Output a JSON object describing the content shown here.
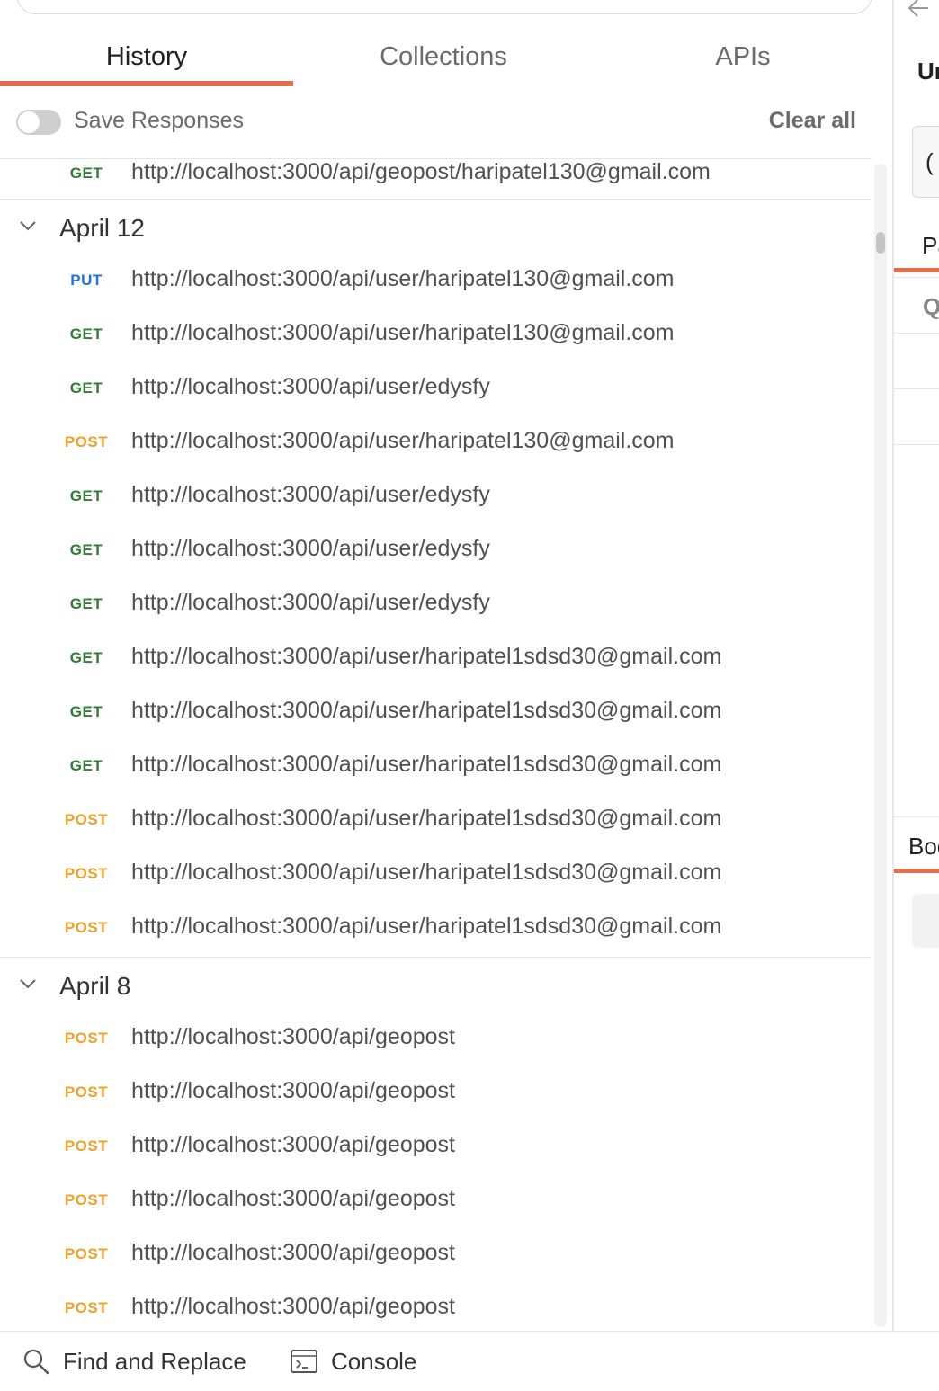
{
  "tabs": [
    {
      "label": "History"
    },
    {
      "label": "Collections"
    },
    {
      "label": "APIs"
    }
  ],
  "toolbar": {
    "save_responses_label": "Save Responses",
    "save_responses_on": false,
    "clear_all_label": "Clear all"
  },
  "history": {
    "top_row": {
      "method": "GET",
      "url": "http://localhost:3000/api/geopost/haripatel130@gmail.com"
    },
    "groups": [
      {
        "date": "April 12",
        "items": [
          {
            "method": "PUT",
            "url": "http://localhost:3000/api/user/haripatel130@gmail.com"
          },
          {
            "method": "GET",
            "url": "http://localhost:3000/api/user/haripatel130@gmail.com"
          },
          {
            "method": "GET",
            "url": "http://localhost:3000/api/user/edysfy"
          },
          {
            "method": "POST",
            "url": "http://localhost:3000/api/user/haripatel130@gmail.com"
          },
          {
            "method": "GET",
            "url": "http://localhost:3000/api/user/edysfy"
          },
          {
            "method": "GET",
            "url": "http://localhost:3000/api/user/edysfy"
          },
          {
            "method": "GET",
            "url": "http://localhost:3000/api/user/edysfy"
          },
          {
            "method": "GET",
            "url": "http://localhost:3000/api/user/haripatel1sdsd30@gmail.com"
          },
          {
            "method": "GET",
            "url": "http://localhost:3000/api/user/haripatel1sdsd30@gmail.com"
          },
          {
            "method": "GET",
            "url": "http://localhost:3000/api/user/haripatel1sdsd30@gmail.com"
          },
          {
            "method": "POST",
            "url": "http://localhost:3000/api/user/haripatel1sdsd30@gmail.com"
          },
          {
            "method": "POST",
            "url": "http://localhost:3000/api/user/haripatel1sdsd30@gmail.com"
          },
          {
            "method": "POST",
            "url": "http://localhost:3000/api/user/haripatel1sdsd30@gmail.com"
          }
        ]
      },
      {
        "date": "April 8",
        "items": [
          {
            "method": "POST",
            "url": "http://localhost:3000/api/geopost"
          },
          {
            "method": "POST",
            "url": "http://localhost:3000/api/geopost"
          },
          {
            "method": "POST",
            "url": "http://localhost:3000/api/geopost"
          },
          {
            "method": "POST",
            "url": "http://localhost:3000/api/geopost"
          },
          {
            "method": "POST",
            "url": "http://localhost:3000/api/geopost"
          },
          {
            "method": "POST",
            "url": "http://localhost:3000/api/geopost"
          }
        ]
      }
    ]
  },
  "method_colors": {
    "GET": "#2e7d32",
    "POST": "#f0a02a",
    "PUT": "#1a73e8"
  },
  "bottom_bar": {
    "find_replace_label": "Find and Replace",
    "find_replace_icon": "search-icon",
    "console_label": "Console",
    "console_icon": "console-icon"
  },
  "right_panel": {
    "title_fragment": "Ur",
    "button_fragment": "(",
    "tab_fragment": "Pa",
    "row_fragment": "Q",
    "section_fragment": "Boo"
  },
  "accent_color": "#e0704a"
}
